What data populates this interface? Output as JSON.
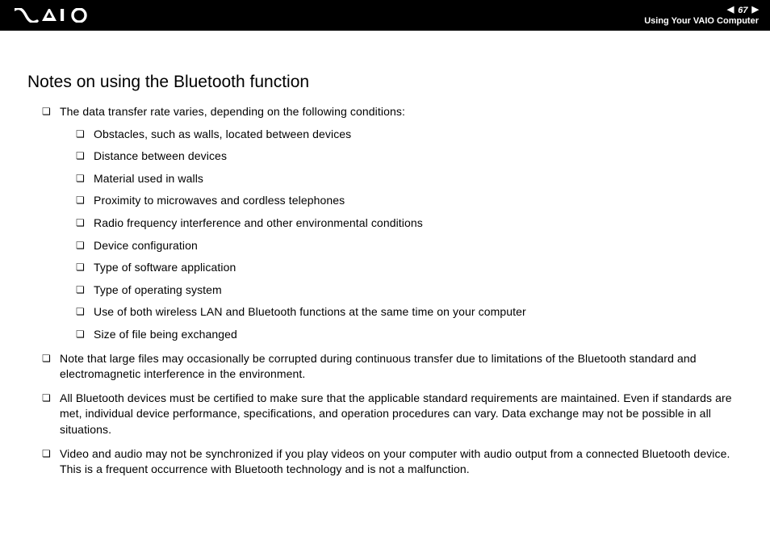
{
  "header": {
    "page_number": "67",
    "section": "Using Your VAIO Computer"
  },
  "content": {
    "heading": "Notes on using the Bluetooth function",
    "items": [
      {
        "text": "The data transfer rate varies, depending on the following conditions:",
        "subitems": [
          "Obstacles, such as walls, located between devices",
          "Distance between devices",
          "Material used in walls",
          "Proximity to microwaves and cordless telephones",
          "Radio frequency interference and other environmental conditions",
          "Device configuration",
          "Type of software application",
          "Type of operating system",
          "Use of both wireless LAN and Bluetooth functions at the same time on your computer",
          "Size of file being exchanged"
        ]
      },
      {
        "text": "Note that large files may occasionally be corrupted during continuous transfer due to limitations of the Bluetooth standard and electromagnetic interference in the environment."
      },
      {
        "text": "All Bluetooth devices must be certified to make sure that the applicable standard requirements are maintained. Even if standards are met, individual device performance, specifications, and operation procedures can vary. Data exchange may not be possible in all situations."
      },
      {
        "text": "Video and audio may not be synchronized if you play videos on your computer with audio output from a connected Bluetooth device. This is a frequent occurrence with Bluetooth technology and is not a malfunction."
      }
    ]
  }
}
